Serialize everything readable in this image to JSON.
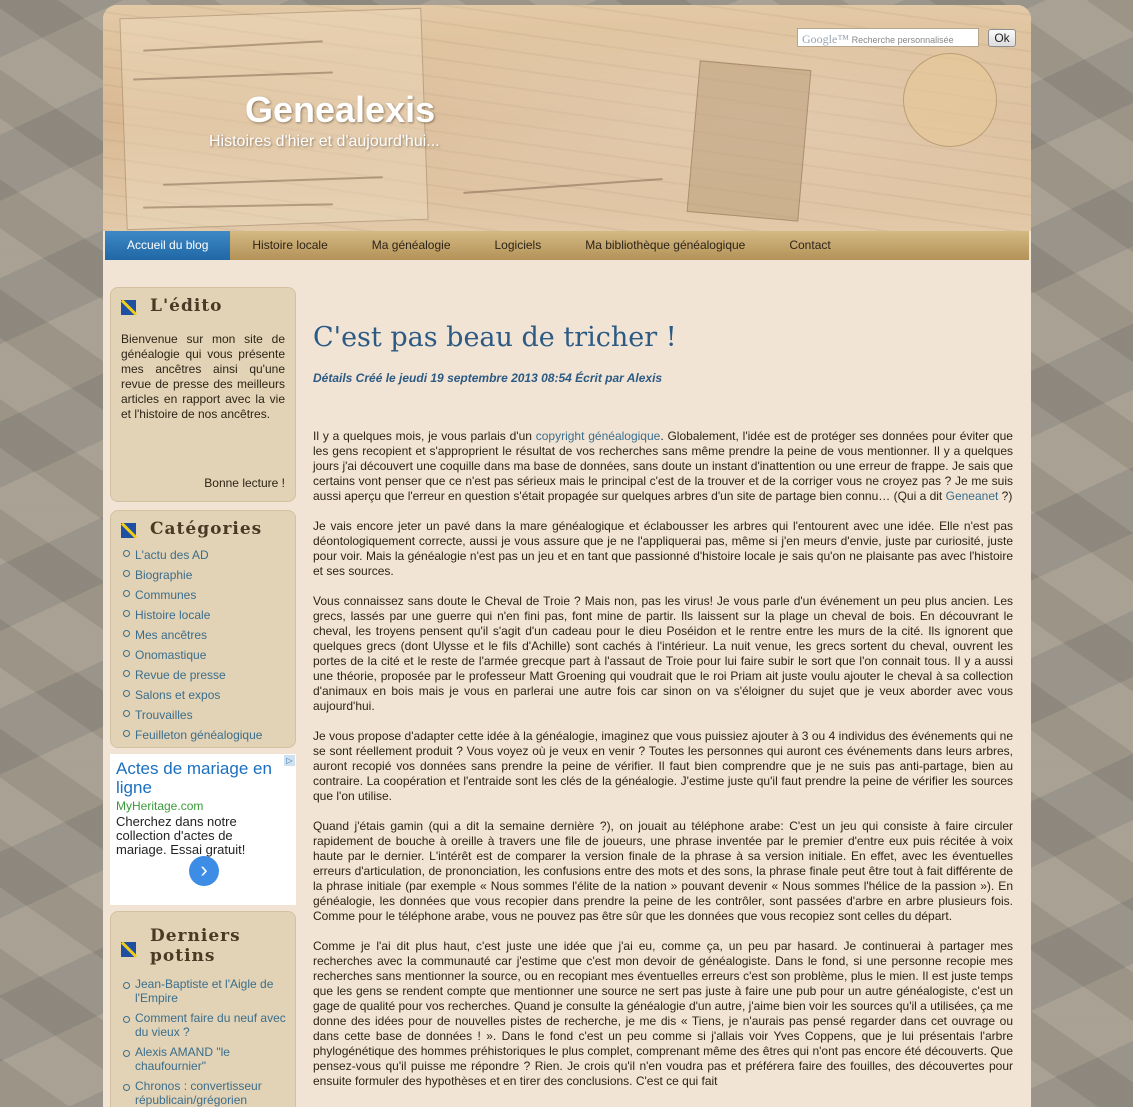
{
  "header": {
    "site_title": "Genealexis",
    "tagline": "Histoires d'hier et d'aujourd'hui...",
    "search_logo": "Google™",
    "search_placeholder": "Recherche personnalisée",
    "search_button": "Ok"
  },
  "nav": {
    "items": [
      "Accueil du blog",
      "Histoire locale",
      "Ma généalogie",
      "Logiciels",
      "Ma bibliothèque généalogique",
      "Contact"
    ],
    "active_index": 0
  },
  "sidebar": {
    "edito": {
      "title": "L'édito",
      "text": "Bienvenue sur mon site de généalogie qui vous présente mes ancêtres ainsi qu'une revue de presse des meilleurs articles en rapport avec la vie et l'histoire de nos ancêtres.",
      "signoff": "Bonne lecture !"
    },
    "categories": {
      "title": "Catégories",
      "items": [
        "L'actu des AD",
        "Biographie",
        "Communes",
        "Histoire locale",
        "Mes ancêtres",
        "Onomastique",
        "Revue de presse",
        "Salons et expos",
        "Trouvailles",
        "Feuilleton généalogique"
      ]
    },
    "ad": {
      "title": "Actes de mariage en ligne",
      "domain": "MyHeritage.com",
      "text": "Cherchez dans notre collection d'actes de mariage. Essai gratuit!",
      "arrow": "›"
    },
    "recent": {
      "title": "Derniers potins",
      "items": [
        "Jean-Baptiste et l'Aigle de l'Empire",
        "Comment faire du neuf avec du vieux ?",
        "Alexis AMAND \"le chaufournier\"",
        "Chronos : convertisseur républicain/grégorien"
      ]
    }
  },
  "article": {
    "title": "C'est pas beau de tricher !",
    "meta": "Détails Créé le jeudi 19 septembre 2013 08:54 Écrit par Alexis",
    "p1_a": "Il y a quelques mois, je vous parlais d'un ",
    "p1_link": "copyright généalogique",
    "p1_b": ". Globalement, l'idée est de protéger ses données pour éviter que les gens recopient et s'approprient le résultat de vos recherches sans même prendre la peine de vous mentionner. Il y a quelques jours j'ai découvert une coquille dans ma base de données, sans doute un instant d'inattention ou une erreur de frappe. Je sais que certains vont penser que ce n'est pas sérieux mais le principal c'est de la trouver et de la corriger vous ne croyez pas ? Je me suis aussi aperçu que l'erreur en question s'était propagée sur quelques arbres d'un site de partage bien connu… (Qui a dit ",
    "p1_link2": "Geneanet",
    "p1_c": " ?)",
    "p2": "Je vais encore jeter un pavé dans la mare généalogique et éclabousser les arbres qui l'entourent avec une idée. Elle n'est pas déontologiquement correcte, aussi je vous assure que je ne l'appliquerai pas, même si j'en meurs d'envie, juste par curiosité, juste pour voir. Mais la généalogie n'est pas un jeu et en tant que passionné d'histoire locale je sais qu'on ne plaisante pas avec l'histoire et ses sources.",
    "p3": "Vous connaissez sans doute le Cheval de Troie ? Mais non, pas les virus! Je vous parle d'un événement un peu plus ancien. Les grecs, lassés par une guerre qui n'en fini pas, font mine de partir. Ils laissent sur la plage un cheval de bois. En découvrant le cheval, les troyens pensent qu'il s'agit d'un cadeau pour le dieu Poséidon et le rentre entre les murs de la cité. Ils ignorent que quelques grecs (dont Ulysse et le fils d'Achille) sont cachés à l'intérieur.  La nuit venue, les grecs sortent du cheval, ouvrent les portes de la cité et le reste de l'armée grecque part à l'assaut de Troie pour lui faire subir le sort que l'on connait tous. Il y a aussi une théorie, proposée par le professeur Matt Groening qui voudrait que le roi Priam ait juste voulu ajouter le cheval à sa collection d'animaux en bois mais je vous en parlerai une autre fois car sinon on va s'éloigner du sujet que je veux aborder avec vous aujourd'hui.",
    "p4": "Je vous propose d'adapter cette idée à la généalogie, imaginez que vous puissiez ajouter à 3 ou 4 individus des événements qui ne se sont réellement produit ? Vous voyez où je veux en venir ? Toutes les personnes qui auront ces événements dans leurs arbres, auront recopié vos données sans prendre la peine de vérifier. Il faut bien comprendre que je ne suis pas anti-partage, bien au contraire. La coopération et l'entraide sont les clés de la généalogie. J'estime juste qu'il faut prendre la peine de vérifier les sources que l'on utilise.",
    "p5": "Quand j'étais gamin (qui a dit la semaine dernière ?), on jouait au téléphone arabe: C'est un jeu qui consiste à faire circuler rapidement de bouche à oreille à travers une file de joueurs, une phrase inventée par le premier d'entre eux puis récitée à voix haute par le dernier. L'intérêt est de comparer la version finale de la phrase à sa version initiale. En effet, avec les éventuelles erreurs d'articulation, de prononciation, les confusions entre des mots et des sons, la phrase finale peut être tout à fait différente de la phrase initiale (par exemple « Nous sommes l'élite de la nation » pouvant devenir « Nous sommes l'hélice de la passion »). En généalogie, les données que vous recopier dans prendre la peine de les contrôler, sont passées d'arbre en arbre plusieurs fois. Comme pour le téléphone arabe, vous ne pouvez pas être sûr que les données que vous recopiez sont celles du départ.",
    "p6": "Comme je l'ai dit plus haut, c'est juste une idée que j'ai eu, comme ça, un peu par hasard. Je continuerai à partager mes recherches avec la communauté car j'estime que c'est mon devoir de généalogiste. Dans le fond, si une personne recopie mes recherches sans mentionner la source, ou en recopiant mes éventuelles erreurs c'est son problème, plus le mien. Il est juste temps que les gens se rendent compte que mentionner une source ne sert pas juste à faire une pub pour un autre généalogiste, c'est un gage de qualité pour vos recherches. Quand je consulte la généalogie d'un autre, j'aime bien voir les sources qu'il a utilisées, ça me donne des idées pour de nouvelles pistes de recherche, je me dis « Tiens, je n'aurais pas pensé regarder dans cet ouvrage ou dans cette base de données ! ». Dans le fond c'est un peu comme si j'allais voir Yves Coppens, que je lui présentais l'arbre phylogénétique des hommes préhistoriques le plus complet, comprenant même des êtres qui n'ont pas encore été découverts. Que pensez-vous qu'il puisse me répondre ? Rien. Je crois qu'il n'en voudra pas et préférera faire des fouilles, des découvertes pour ensuite formuler des hypothèses et en tirer des conclusions. C'est ce qui fait"
  }
}
